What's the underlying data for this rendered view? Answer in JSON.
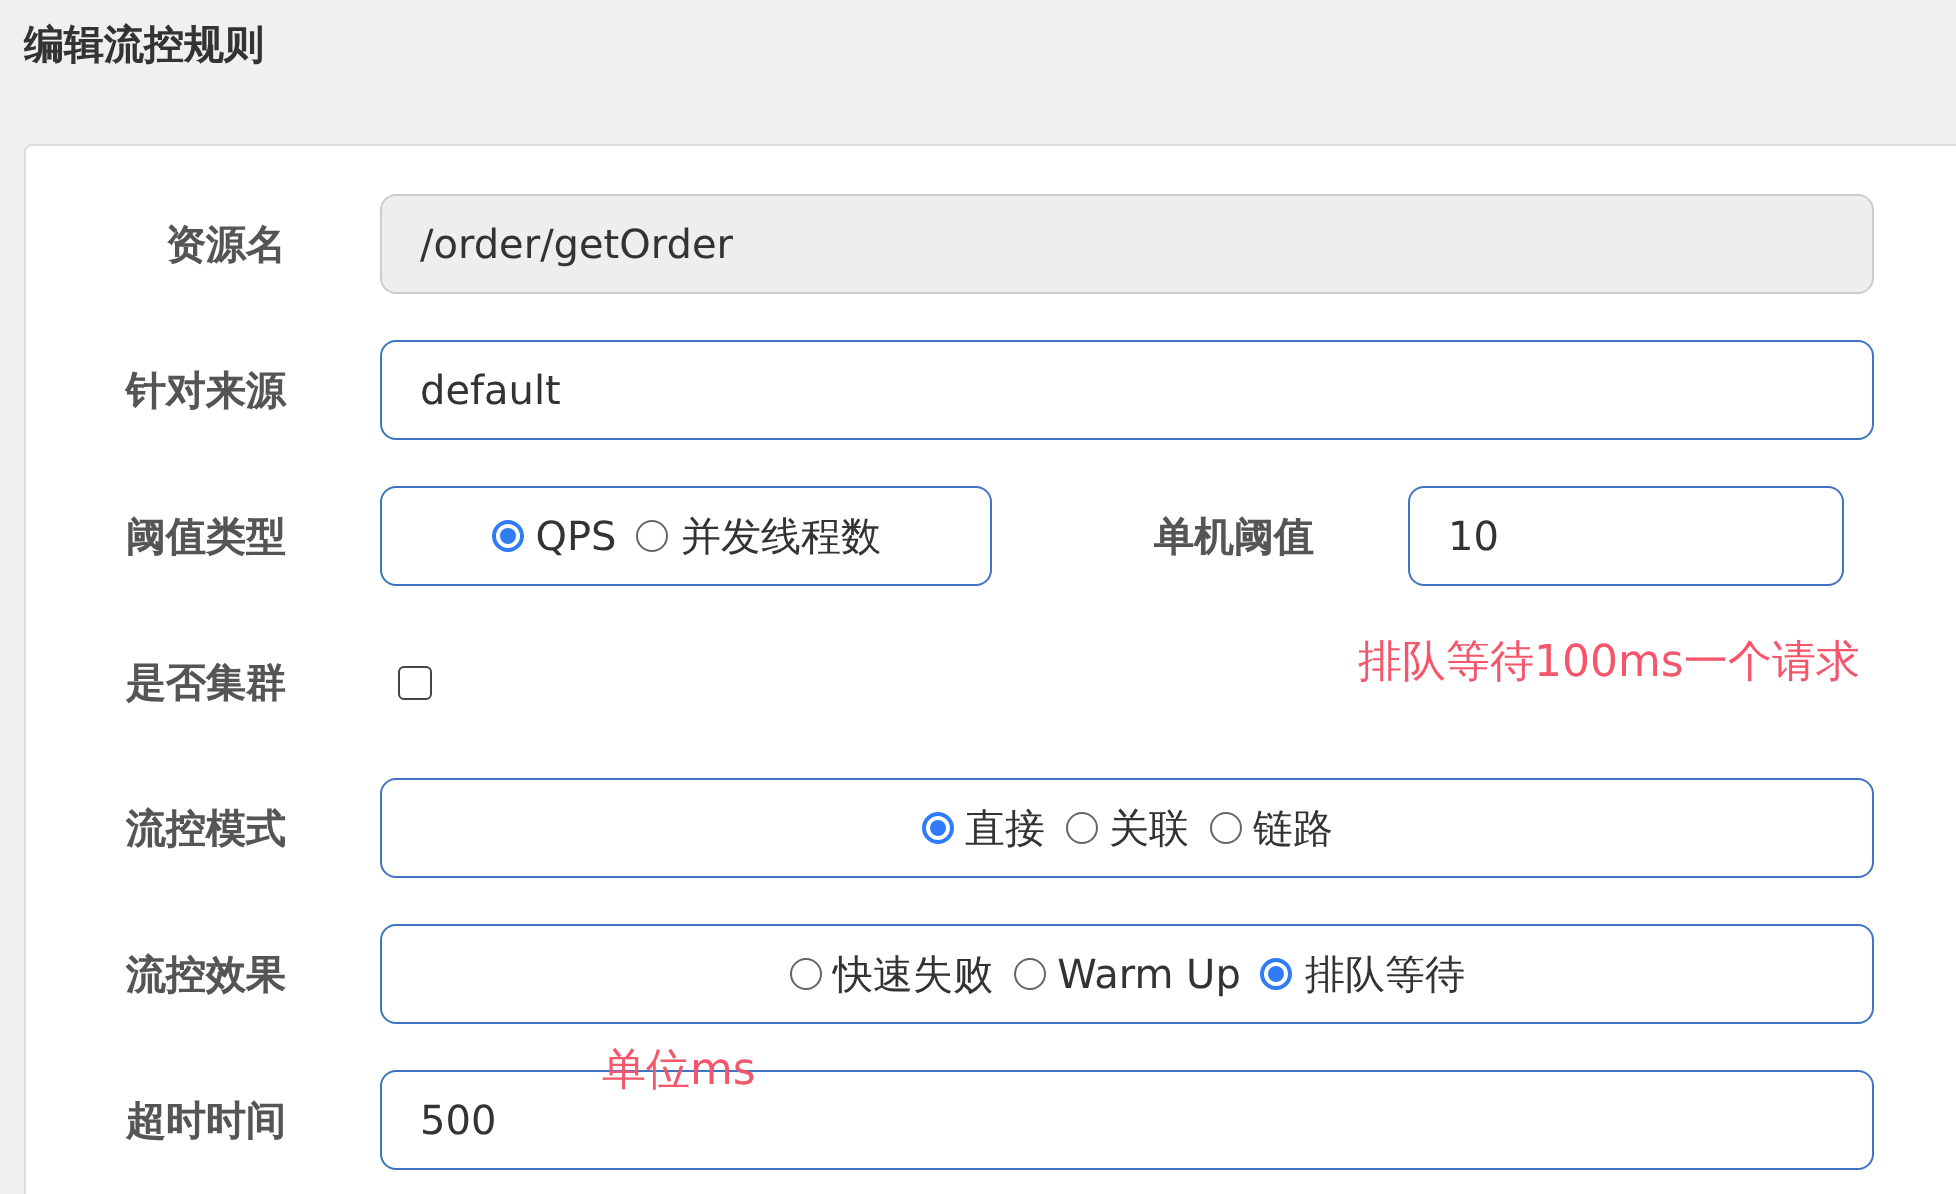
{
  "title": "编辑流控规则",
  "fields": [
    {
      "kind": "text",
      "label": "资源名",
      "value": "/order/getOrder",
      "disabled": true
    },
    {
      "kind": "text",
      "label": "针对来源",
      "value": "default",
      "disabled": false
    },
    {
      "kind": "threshold",
      "label": "阈值类型",
      "options": [
        {
          "label": "QPS",
          "selected": true
        },
        {
          "label": "并发线程数",
          "selected": false
        }
      ],
      "side_label": "单机阈值",
      "value": "10"
    },
    {
      "kind": "checkbox",
      "label": "是否集群",
      "checked": false
    },
    {
      "kind": "radio",
      "label": "流控模式",
      "options": [
        {
          "label": "直接",
          "selected": true
        },
        {
          "label": "关联",
          "selected": false
        },
        {
          "label": "链路",
          "selected": false
        }
      ]
    },
    {
      "kind": "radio",
      "label": "流控效果",
      "options": [
        {
          "label": "快速失败",
          "selected": false
        },
        {
          "label": "Warm Up",
          "selected": false
        },
        {
          "label": "排队等待",
          "selected": true
        }
      ]
    },
    {
      "kind": "text",
      "label": "超时时间",
      "value": "500",
      "disabled": false
    }
  ],
  "annotations": [
    {
      "text": "排队等待100ms一个请求"
    },
    {
      "text": "单位ms"
    }
  ]
}
